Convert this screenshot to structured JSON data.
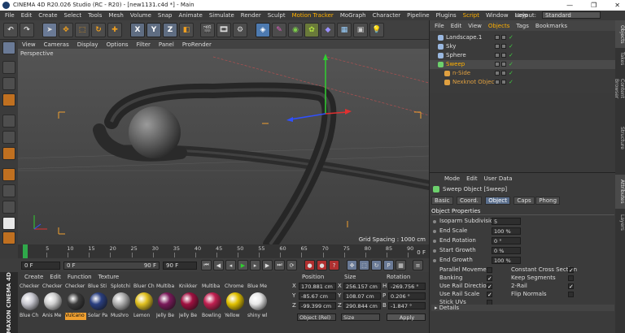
{
  "window": {
    "title": "CINEMA 4D R20.026 Studio (RC - R20) - [new1131.c4d *] - Main",
    "controls": [
      "—",
      "❐",
      "✕"
    ]
  },
  "menubar": {
    "items": [
      "File",
      "Edit",
      "Create",
      "Select",
      "Tools",
      "Mesh",
      "Volume",
      "Snap",
      "Animate",
      "Simulate",
      "Render",
      "Sculpt",
      "Motion Tracker",
      "MoGraph",
      "Character",
      "Pipeline",
      "Plugins",
      "Script",
      "Window",
      "Help"
    ],
    "layout_label": "Layout:",
    "layout_value": "Standard"
  },
  "toolbar": {
    "axis_x": "X",
    "axis_y": "Y",
    "axis_z": "Z"
  },
  "viewport": {
    "menu": [
      "View",
      "Cameras",
      "Display",
      "Options",
      "Filter",
      "Panel",
      "ProRender"
    ],
    "camera_label": "Perspective",
    "grid_spacing": "Grid Spacing : 1000 cm"
  },
  "timeline": {
    "ticks": [
      "0",
      "5",
      "10",
      "15",
      "20",
      "25",
      "30",
      "35",
      "40",
      "45",
      "50",
      "55",
      "60",
      "65",
      "70",
      "75",
      "80",
      "85",
      "90"
    ],
    "end_label": "0 F"
  },
  "transport": {
    "current_frame": "0 F",
    "start_frame": "0 F",
    "end_frame": "90 F",
    "preview_end": "90 F"
  },
  "materials": {
    "menu": [
      "Create",
      "Edit",
      "Function",
      "Texture"
    ],
    "items": [
      {
        "top": "Checker",
        "bottom": "Blue Ch",
        "color": "#c8c8d0"
      },
      {
        "top": "Checker",
        "bottom": "Anis Me",
        "color": "#d0d0d0"
      },
      {
        "top": "Checker",
        "bottom": "Vulcano",
        "color": "#3a3a3a"
      },
      {
        "top": "Blue Sti",
        "bottom": "Solar Pa",
        "color": "#2a3f80"
      },
      {
        "top": "Splotchi",
        "bottom": "Mushro",
        "color": "#b0b0b0"
      },
      {
        "top": "Bluer Ch",
        "bottom": "Lemon",
        "color": "#e0c020"
      },
      {
        "top": "Multiba",
        "bottom": "Jelly Be",
        "color": "#7a1a5a"
      },
      {
        "top": "Knikker",
        "bottom": "Jelly Be",
        "color": "#a01040"
      },
      {
        "top": "Multiba",
        "bottom": "Bowling",
        "color": "#c02050"
      },
      {
        "top": "Chrome",
        "bottom": "Yellow",
        "color": "#e0c000"
      },
      {
        "top": "Blue Me",
        "bottom": "shiny wl",
        "color": "#e8e8e8"
      }
    ],
    "brand": "MAXON CINEMA 4D"
  },
  "coordinates": {
    "headers": [
      "Position",
      "Size",
      "Rotation"
    ],
    "rows": [
      {
        "axis": "X",
        "pos": "170.881 cm",
        "size": "256.157 cm",
        "rot_axis": "H",
        "rot": "-269.756 °"
      },
      {
        "axis": "Y",
        "pos": "-85.67 cm",
        "size": "108.07 cm",
        "rot_axis": "P",
        "rot": "0.206 °"
      },
      {
        "axis": "Z",
        "pos": "-99.399 cm",
        "size": "290.844 cm",
        "rot_axis": "B",
        "rot": "-1.847 °"
      }
    ],
    "mode_select": "Object (Rel)",
    "size_select": "Size",
    "apply_label": "Apply"
  },
  "object_manager": {
    "menu": [
      "File",
      "Edit",
      "View",
      "Objects",
      "Tags",
      "Bookmarks"
    ],
    "objects": [
      {
        "name": "Landscape.1",
        "indent": 0,
        "color": "#9ab8e0",
        "active": false
      },
      {
        "name": "Sky",
        "indent": 0,
        "color": "#9ab8e0",
        "active": false
      },
      {
        "name": "Sphere",
        "indent": 0,
        "color": "#9ab8e0",
        "active": false
      },
      {
        "name": "Sweep",
        "indent": 0,
        "color": "#6cd06c",
        "active": true
      },
      {
        "name": "n-Side",
        "indent": 1,
        "color": "#e0a040",
        "active": false
      },
      {
        "name": "Nexknot Object",
        "indent": 1,
        "color": "#e0a040",
        "active": false
      }
    ]
  },
  "attributes": {
    "menu": [
      "Mode",
      "Edit",
      "User Data"
    ],
    "object_title": "Sweep Object [Sweep]",
    "tabs": [
      "Basic",
      "Coord.",
      "Object",
      "Caps",
      "Phong"
    ],
    "active_tab": "Object",
    "section": "Object Properties",
    "fields": [
      {
        "label": "Isoparm Subdivision",
        "value": "5"
      },
      {
        "label": "End Scale",
        "value": "100 %"
      },
      {
        "label": "End Rotation",
        "value": "0 °"
      },
      {
        "label": "Start Growth",
        "value": "0 %"
      },
      {
        "label": "End Growth",
        "value": "100 %"
      }
    ],
    "checks_left": [
      {
        "label": "Parallel Movement",
        "checked": false
      },
      {
        "label": "Banking",
        "checked": true
      },
      {
        "label": "Use Rail Direction",
        "checked": true
      },
      {
        "label": "Use Rail Scale",
        "checked": true
      },
      {
        "label": "Stick UVs",
        "checked": false
      }
    ],
    "checks_right": [
      {
        "label": "Constant Cross Section",
        "checked": true
      },
      {
        "label": "Keep Segments",
        "checked": false
      },
      {
        "label": "2-Rail",
        "checked": true
      },
      {
        "label": "Flip Normals",
        "checked": false
      }
    ],
    "details": "Details"
  },
  "right_tabs": [
    "Objects",
    "Takes",
    "Content Browser",
    "Structure",
    "Attributes",
    "Layers"
  ]
}
